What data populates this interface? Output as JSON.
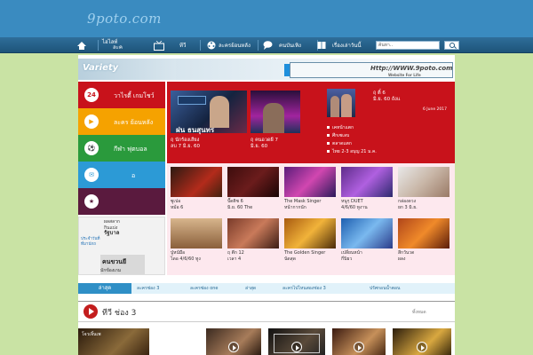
{
  "header": {
    "logo": "9poto.com"
  },
  "nav": {
    "items": [
      {
        "label": "ไฮไลท์",
        "sub": "ละค"
      },
      {
        "label": "ทีวี"
      },
      {
        "label": "ละครย้อนหลัง"
      },
      {
        "label": "คนบันเทิง"
      },
      {
        "label": "เรื่องเล่าวันนี้"
      }
    ],
    "search_placeholder": "ค้นหา.."
  },
  "banner": {
    "title": "Variety",
    "url": "Http://WWW.9poto.com",
    "tagline": "Website For Life"
  },
  "menu": [
    {
      "icon_text": "24",
      "label": "วาไรตี้ เกมโชว์",
      "color": "#c8121b"
    },
    {
      "icon_text": "▶",
      "label": "ละคร ย้อนหลัง",
      "color": "#f5a200"
    },
    {
      "icon_text": "⚽",
      "label": "กีฬา ฟุตบอล",
      "color": "#2a9a3c"
    },
    {
      "icon_text": "✉",
      "label": "อ",
      "color": "#2c9ad6"
    },
    {
      "icon_text": "★",
      "label": "",
      "color": "#5a1a3e"
    }
  ],
  "feature": {
    "main_caption": "ฝน ธนสุนทร",
    "thumb1": {
      "line1": "ฤ นักร้องเสียง",
      "line2": "ลบ 7 มิ.ย. 60"
    },
    "thumb2": {
      "line1": "ฤ คนอวดผี 7",
      "line2": "มิ.ย. 60"
    },
    "thumb3": {
      "line1": "ฤ ตี๋ 6",
      "line2": "มิ.ย. 60 ถังแ",
      "date": "6 June 2017"
    },
    "list": [
      "เคหน้าแตก",
      "ศึกเซเลบ",
      "ตลาดแตก",
      "ไทย 2-3 อบุญ 21 ม.ค."
    ]
  },
  "grid": [
    {
      "line1": "ซูเปอ",
      "line2": "หม้อ 6"
    },
    {
      "line1": "ปั๊ดติช 6",
      "line2": "มิ.ย. 60 The"
    },
    {
      "line1": "The Mask Singer",
      "line2": "หน้ากากนัก"
    },
    {
      "line1": "หนูๆ DUET",
      "line2": "4/6/60 ทูงาน"
    },
    {
      "line1": "กล่องดวง",
      "line2": "ยก 3 มิ.ย."
    },
    {
      "line1": "ปู่หน้มือ",
      "line2": "ไดอ 4/6/60 ทูง"
    },
    {
      "line1": "ฤ ตีก 12",
      "line2": "เวลา 4"
    },
    {
      "line1": "The Golden Singer",
      "line2": "นัดสุด"
    },
    {
      "line1": "เปลี่ยนหน้า",
      "line2": "กี่นิยว"
    },
    {
      "line1": "สีกวันวด",
      "line2": "ผลง"
    }
  ],
  "ad": {
    "lines": [
      "ผลสลาก",
      "กินแบ่ง",
      "รัฐบาล",
      "ประจำวันที่",
      "ที่มานักถ",
      "คนขวนยี",
      "มักข้องเกม"
    ]
  },
  "tabs": [
    "ล่าสุด",
    "ละครช่อง 3",
    "ละครช่อง one",
    "ล่าสุด",
    "ละครไปไหนสองช่อง 3",
    "ปรัศกอนน้ำตอน"
  ],
  "channel": {
    "title": "ทีวี ช่อง 3",
    "more": "ทั้งหมด"
  },
  "bottom_caption": "โจวเจิ้นเพ"
}
